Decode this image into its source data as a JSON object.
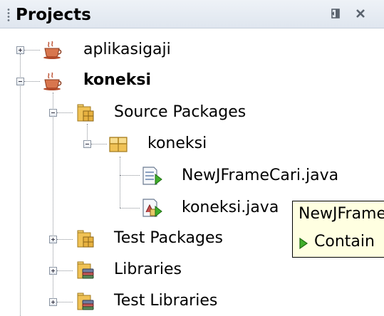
{
  "panel": {
    "title": "Projects",
    "minimize_icon": "minimize-window-icon",
    "close_icon": "close-icon"
  },
  "tree": {
    "projects": [
      {
        "label": "aplikasigaji",
        "icon": "java-project-icon",
        "expanded": false,
        "bold": false
      },
      {
        "label": "koneksi",
        "icon": "java-project-icon",
        "expanded": true,
        "bold": true,
        "children": [
          {
            "label": "Source Packages",
            "icon": "source-folder-icon",
            "expanded": true,
            "children": [
              {
                "label": "koneksi",
                "icon": "package-icon",
                "expanded": true,
                "children": [
                  {
                    "label": "NewJFrameCari.java",
                    "icon": "jframe-form-icon"
                  },
                  {
                    "label": "koneksi.java",
                    "icon": "java-class-icon"
                  }
                ]
              }
            ]
          },
          {
            "label": "Test Packages",
            "icon": "test-folder-icon",
            "expanded": false
          },
          {
            "label": "Libraries",
            "icon": "library-folder-icon",
            "expanded": false
          },
          {
            "label": "Test Libraries",
            "icon": "library-folder-icon",
            "expanded": false
          }
        ]
      }
    ]
  },
  "tooltip": {
    "line1": "NewJFrame",
    "line2": "Contain",
    "arrow_icon": "green-triangle-icon"
  },
  "colors": {
    "tooltip_bg": "#ffffe1",
    "header_bg": "#e6ecf3",
    "folder": "#e8b84a",
    "cup": "#c0583a"
  }
}
